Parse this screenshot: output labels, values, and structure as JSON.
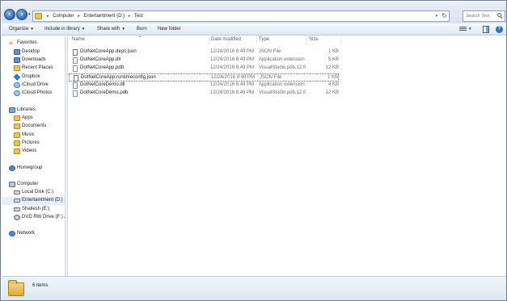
{
  "address": {
    "crumbs": [
      "Computer",
      "Entertaintment (D:)",
      "Test"
    ]
  },
  "search": {
    "placeholder": "Search Test"
  },
  "toolbar": {
    "organize": "Organize",
    "include_in_library": "Include in library",
    "share_with": "Share with",
    "burn": "Burn",
    "new_folder": "New folder"
  },
  "sidebar": {
    "favorites": {
      "label": "Favorites",
      "items": [
        "Desktop",
        "Downloads",
        "Recent Places",
        "Dropbox",
        "iCloud Drive",
        "iCloud Photos"
      ]
    },
    "libraries": {
      "label": "Libraries",
      "items": [
        "Apps",
        "Documents",
        "Music",
        "Pictures",
        "Videos"
      ]
    },
    "homegroup": "Homegroup",
    "computer": {
      "label": "Computer",
      "items": [
        "Local Disk (C:)",
        "Entertaintment (D:)",
        "Shailesh (E:)",
        "DVD RW Drive (F:) A"
      ]
    },
    "network": "Network"
  },
  "columns": {
    "name": "Name",
    "date_modified": "Date modified",
    "type": "Type",
    "size": "Size"
  },
  "files": [
    {
      "name": "DotNetCoreApp.deps.json",
      "date": "12/24/2016 8:49 PM",
      "type": "JSON File",
      "size": "1 KB"
    },
    {
      "name": "DotNetCoreApp.dll",
      "date": "12/24/2016 8:49 PM",
      "type": "Application extension",
      "size": "5 KB"
    },
    {
      "name": "DotNetCoreApp.pdb",
      "date": "12/24/2016 8:49 PM",
      "type": "VisualStudio.pdb.12.0",
      "size": "12 KB"
    },
    {
      "name": "DotNetCoreApp.runtimeconfig.json",
      "date": "12/24/2016 8:49 PM",
      "type": "JSON File",
      "size": "1 KB"
    },
    {
      "name": "DotNetCoreDemo.dll",
      "date": "12/24/2016 8:49 PM",
      "type": "Application extension",
      "size": "4 KB"
    },
    {
      "name": "DotNetCoreDemo.pdb",
      "date": "12/24/2016 8:49 PM",
      "type": "VisualStudio.pdb.12.0",
      "size": "12 KB"
    }
  ],
  "status": {
    "item_count": "6 items"
  },
  "icons": {
    "back": "back-arrow-icon",
    "forward": "forward-arrow-icon",
    "refresh": "refresh-icon",
    "search": "search-icon",
    "help": "help-icon"
  }
}
